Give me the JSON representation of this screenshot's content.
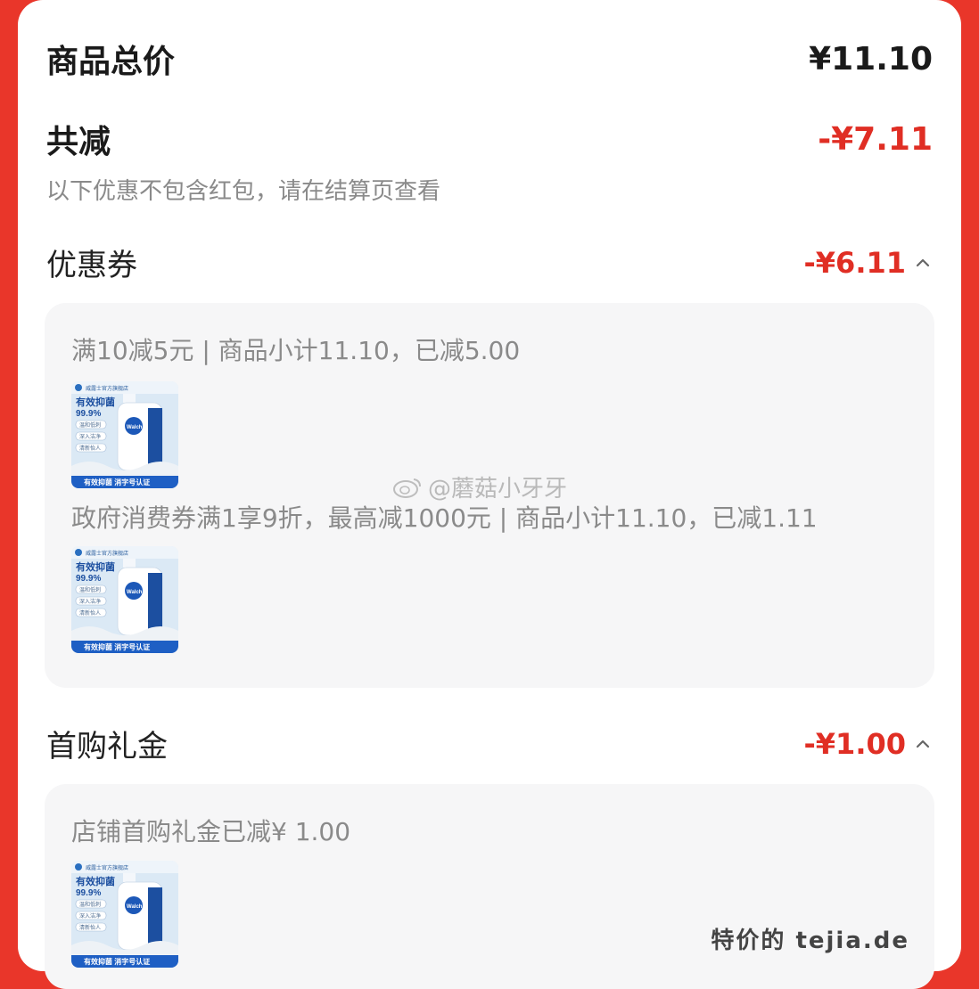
{
  "summary": {
    "total_label": "商品总价",
    "total_value": "¥11.10",
    "reduce_label": "共减",
    "reduce_value": "-¥7.11",
    "note": "以下优惠不包含红包，请在结算页查看"
  },
  "coupon_section": {
    "title": "优惠券",
    "amount": "-¥6.11",
    "items": [
      {
        "text": "满10减5元 | 商品小计11.10，已减5.00"
      },
      {
        "text": "政府消费券满1享9折，最高减1000元 | 商品小计11.10，已减1.11"
      }
    ]
  },
  "gift_section": {
    "title": "首购礼金",
    "amount": "-¥1.00",
    "items": [
      {
        "text": "店铺首购礼金已减¥ 1.00"
      }
    ]
  },
  "product_image": {
    "store_text": "威露士官方旗舰店",
    "headline": "有效抑菌",
    "percent": "99.9%",
    "bullets": [
      "温和低刺",
      "深入洁净",
      "清新怡人"
    ],
    "brand": "Walch",
    "footer": "有效抑菌  消字号认证"
  },
  "watermark": "@蘑菇小牙牙",
  "footer_watermark": "特价的 tejia.de",
  "colors": {
    "accent_red": "#e02e24",
    "card_bg": "#ffffff",
    "panel_bg": "#f6f6f7",
    "text_gray": "#8a8a8a"
  }
}
